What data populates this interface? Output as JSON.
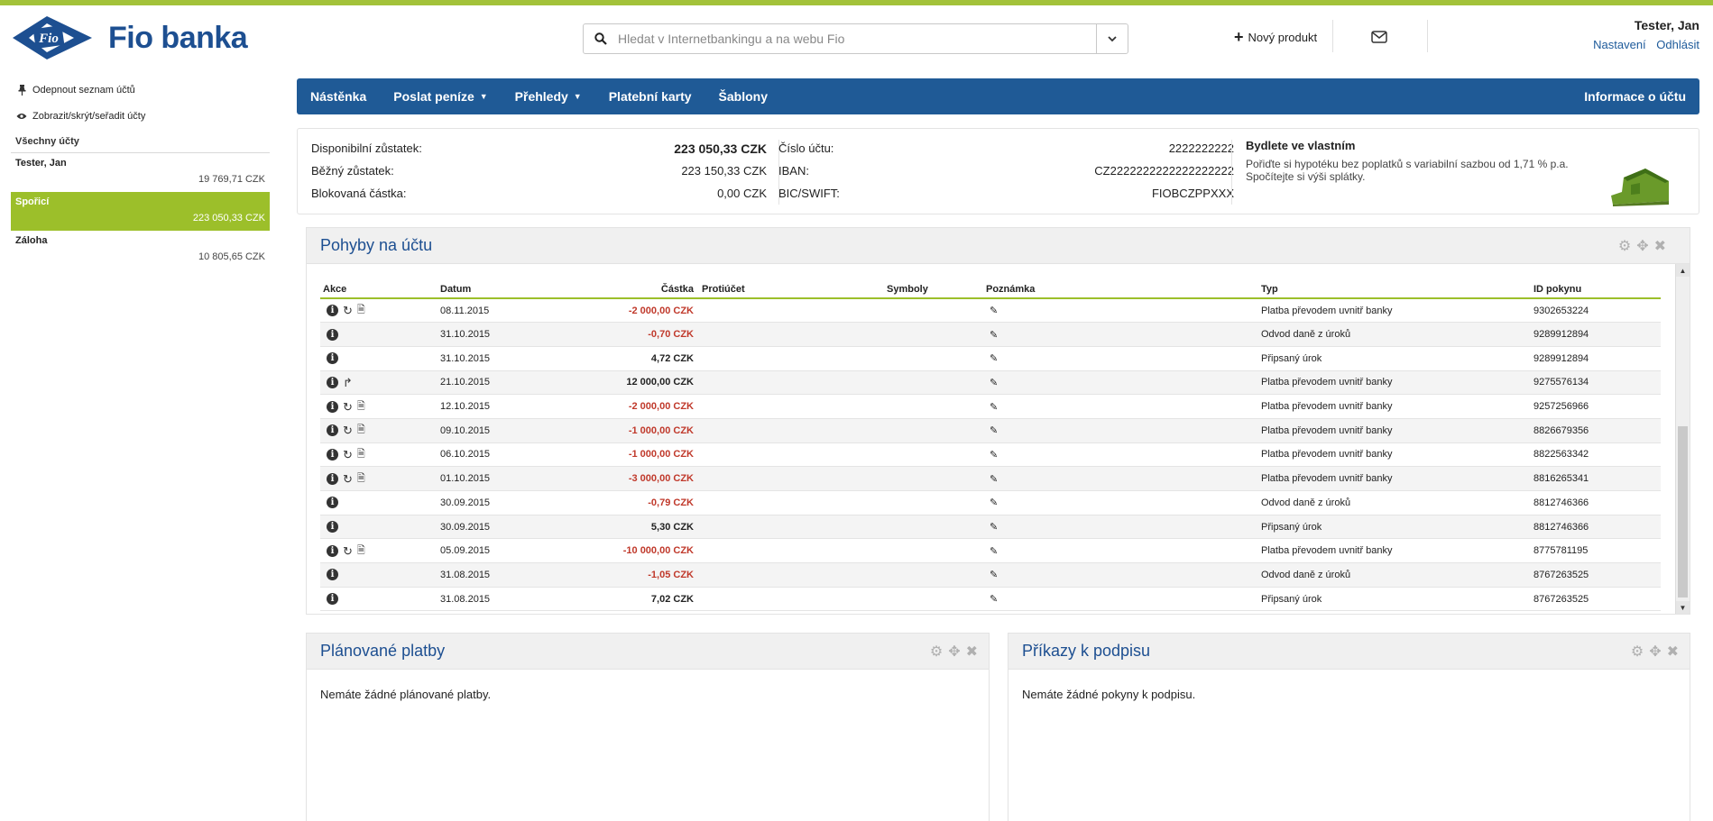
{
  "header": {
    "logo_text": "Fio banka",
    "logo_mark_text": "Fio",
    "search_placeholder": "Hledat v Internetbankingu a na webu Fio",
    "new_product": "Nový produkt",
    "user_name": "Tester, Jan",
    "settings": "Nastavení",
    "logout": "Odhlásit"
  },
  "sidebar": {
    "unpin": "Odepnout seznam účtů",
    "show_hide": "Zobrazit/skrýt/seřadit účty",
    "all_accounts": "Všechny účty",
    "accounts": [
      {
        "name": "Tester, Jan",
        "balance": "19 769,71 CZK"
      },
      {
        "name": "Spořicí",
        "balance": "223 050,33 CZK"
      },
      {
        "name": "Záloha",
        "balance": "10 805,65 CZK"
      }
    ]
  },
  "nav": {
    "items": [
      "Nástěnka",
      "Poslat peníze",
      "Přehledy",
      "Platební karty",
      "Šablony"
    ],
    "right": "Informace o účtu"
  },
  "info": {
    "available_label": "Disponibilní zůstatek:",
    "available_value": "223 050,33 CZK",
    "current_label": "Běžný zůstatek:",
    "current_value": "223 150,33 CZK",
    "blocked_label": "Blokovaná částka:",
    "blocked_value": "0,00 CZK",
    "account_no_label": "Číslo účtu:",
    "account_no_value": "2222222222",
    "iban_label": "IBAN:",
    "iban_value": "CZ2222222222222222222",
    "bic_label": "BIC/SWIFT:",
    "bic_value": "FIOBCZPPXXX",
    "promo_title": "Bydlete ve vlastním",
    "promo_text_1": "Pořiďte si hypotéku bez poplatků s variabilní sazbou od 1,71 % p.a.",
    "promo_text_2": "Spočítejte si výši splátky."
  },
  "movements": {
    "title": "Pohyby na účtu",
    "columns": {
      "akce": "Akce",
      "datum": "Datum",
      "castka": "Částka",
      "protiucet": "Protiúčet",
      "symboly": "Symboly",
      "poznamka": "Poznámka",
      "typ": "Typ",
      "id": "ID pokynu"
    },
    "rows": [
      {
        "date": "08.11.2015",
        "amount": "-2 000,00 CZK",
        "type": "Platba převodem uvnitř banky",
        "id": "9302653224"
      },
      {
        "date": "31.10.2015",
        "amount": "-0,70 CZK",
        "type": "Odvod daně z úroků",
        "id": "9289912894"
      },
      {
        "date": "31.10.2015",
        "amount": "4,72 CZK",
        "type": "Připsaný úrok",
        "id": "9289912894"
      },
      {
        "date": "21.10.2015",
        "amount": "12 000,00 CZK",
        "type": "Platba převodem uvnitř banky",
        "id": "9275576134"
      },
      {
        "date": "12.10.2015",
        "amount": "-2 000,00 CZK",
        "type": "Platba převodem uvnitř banky",
        "id": "9257256966"
      },
      {
        "date": "09.10.2015",
        "amount": "-1 000,00 CZK",
        "type": "Platba převodem uvnitř banky",
        "id": "8826679356"
      },
      {
        "date": "06.10.2015",
        "amount": "-1 000,00 CZK",
        "type": "Platba převodem uvnitř banky",
        "id": "8822563342"
      },
      {
        "date": "01.10.2015",
        "amount": "-3 000,00 CZK",
        "type": "Platba převodem uvnitř banky",
        "id": "8816265341"
      },
      {
        "date": "30.09.2015",
        "amount": "-0,79 CZK",
        "type": "Odvod daně z úroků",
        "id": "8812746366"
      },
      {
        "date": "30.09.2015",
        "amount": "5,30 CZK",
        "type": "Připsaný úrok",
        "id": "8812746366"
      },
      {
        "date": "05.09.2015",
        "amount": "-10 000,00 CZK",
        "type": "Platba převodem uvnitř banky",
        "id": "8775781195"
      },
      {
        "date": "31.08.2015",
        "amount": "-1,05 CZK",
        "type": "Odvod daně z úroků",
        "id": "8767263525"
      },
      {
        "date": "31.08.2015",
        "amount": "7,02 CZK",
        "type": "Připsaný úrok",
        "id": "8767263525"
      }
    ]
  },
  "planned": {
    "title": "Plánované platby",
    "empty": "Nemáte žádné plánované platby."
  },
  "signing": {
    "title": "Příkazy k podpisu",
    "empty": "Nemáte žádné pokyny k podpisu."
  },
  "colors": {
    "accent_green": "#9cbf2a",
    "nav_blue": "#1f5a96",
    "negative_red": "#c0392b"
  }
}
